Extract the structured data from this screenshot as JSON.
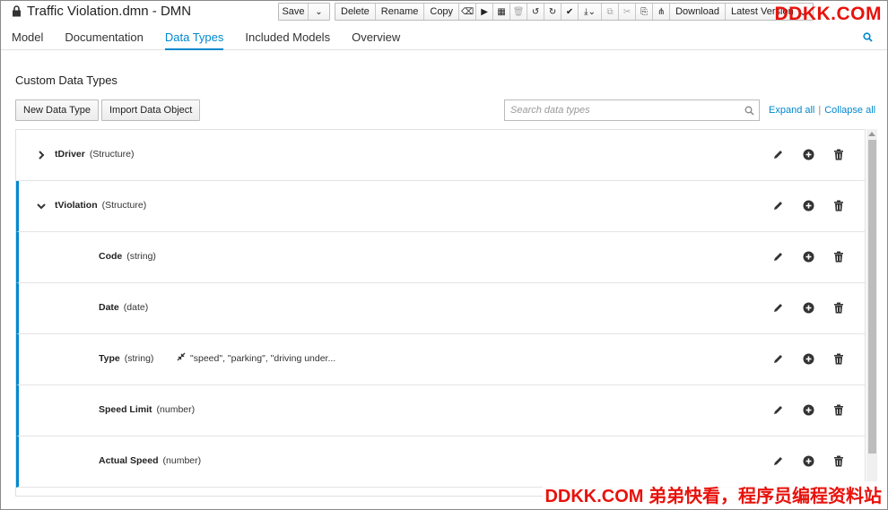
{
  "window": {
    "title": "Traffic Violation.dmn - DMN"
  },
  "toolbar": {
    "save": "Save",
    "delete": "Delete",
    "rename": "Rename",
    "copy": "Copy",
    "download": "Download",
    "latest_version": "Latest Version"
  },
  "watermark": {
    "top": "DDKK.COM",
    "bottom": "DDKK.COM 弟弟快看，程序员编程资料站"
  },
  "nav": {
    "tabs": [
      "Model",
      "Documentation",
      "Data Types",
      "Included Models",
      "Overview"
    ],
    "active": "Data Types"
  },
  "section": {
    "title": "Custom Data Types",
    "new_button": "New Data Type",
    "import_button": "Import Data Object",
    "search_placeholder": "Search data types",
    "expand_all": "Expand all",
    "separator": "|",
    "collapse_all": "Collapse all"
  },
  "data_types": [
    {
      "name": "tDriver",
      "type": "(Structure)",
      "constraint": ""
    },
    {
      "name": "tViolation",
      "type": "(Structure)",
      "constraint": ""
    },
    {
      "name": "Code",
      "type": "(string)",
      "constraint": ""
    },
    {
      "name": "Date",
      "type": "(date)",
      "constraint": ""
    },
    {
      "name": "Type",
      "type": "(string)",
      "constraint": "\"speed\", \"parking\", \"driving under..."
    },
    {
      "name": "Speed Limit",
      "type": "(number)",
      "constraint": ""
    },
    {
      "name": "Actual Speed",
      "type": "(number)",
      "constraint": ""
    }
  ],
  "colors": {
    "accent": "#0088ce",
    "watermark": "#e8120c"
  }
}
